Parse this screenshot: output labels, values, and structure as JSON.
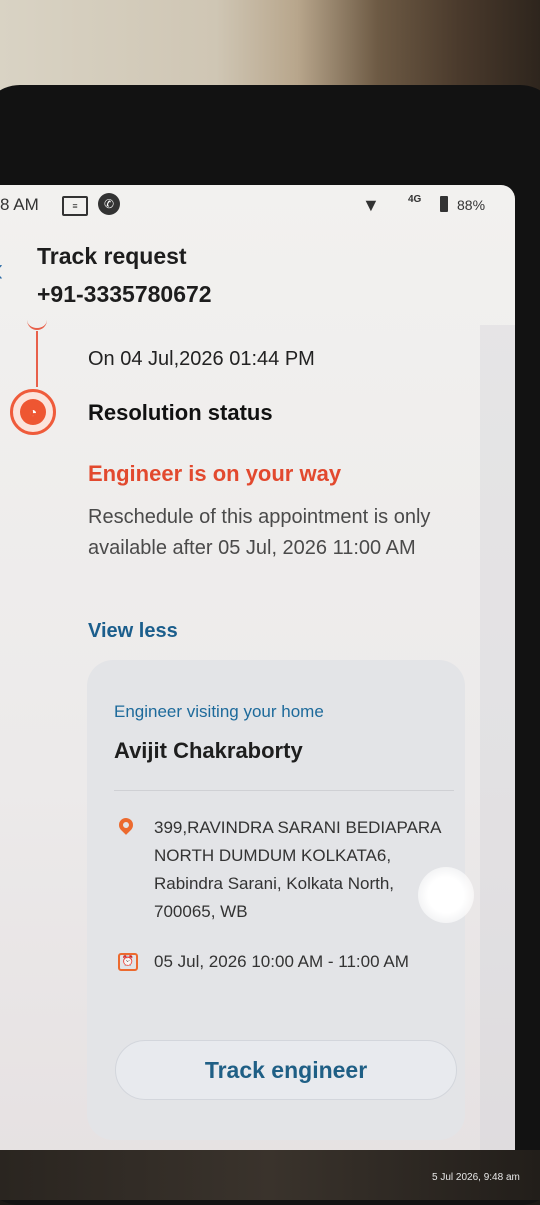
{
  "status_bar": {
    "time": "8 AM",
    "signal_label": "4G",
    "battery": "88%",
    "icons": [
      "message-icon",
      "phone-icon",
      "wifi-icon",
      "signal-icon",
      "battery-icon"
    ]
  },
  "header": {
    "back_icon": "back-arrow-icon",
    "title": "Track request",
    "subtitle": "+91-3335780672"
  },
  "timeline": {
    "timestamp": "On 04 Jul,2026 01:44 PM",
    "step_title": "Resolution status",
    "status_text": "Engineer is on your way",
    "note": "Reschedule of this appointment is only available after 05 Jul, 2026 11:00 AM",
    "toggle_label": "View less"
  },
  "engineer_card": {
    "label": "Engineer visiting your home",
    "name": "Avijit Chakraborty",
    "address": "399,RAVINDRA SARANI BEDIAPARA NORTH DUMDUM KOLKATA6, Rabindra Sarani, Kolkata North, 700065, WB",
    "slot": "05 Jul, 2026 10:00 AM - 11:00 AM",
    "button_label": "Track engineer"
  },
  "photo_timestamp": "5 Jul 2026, 9:48 am",
  "colors": {
    "accent_orange": "#e2492e",
    "link_blue": "#1b5e8c"
  }
}
